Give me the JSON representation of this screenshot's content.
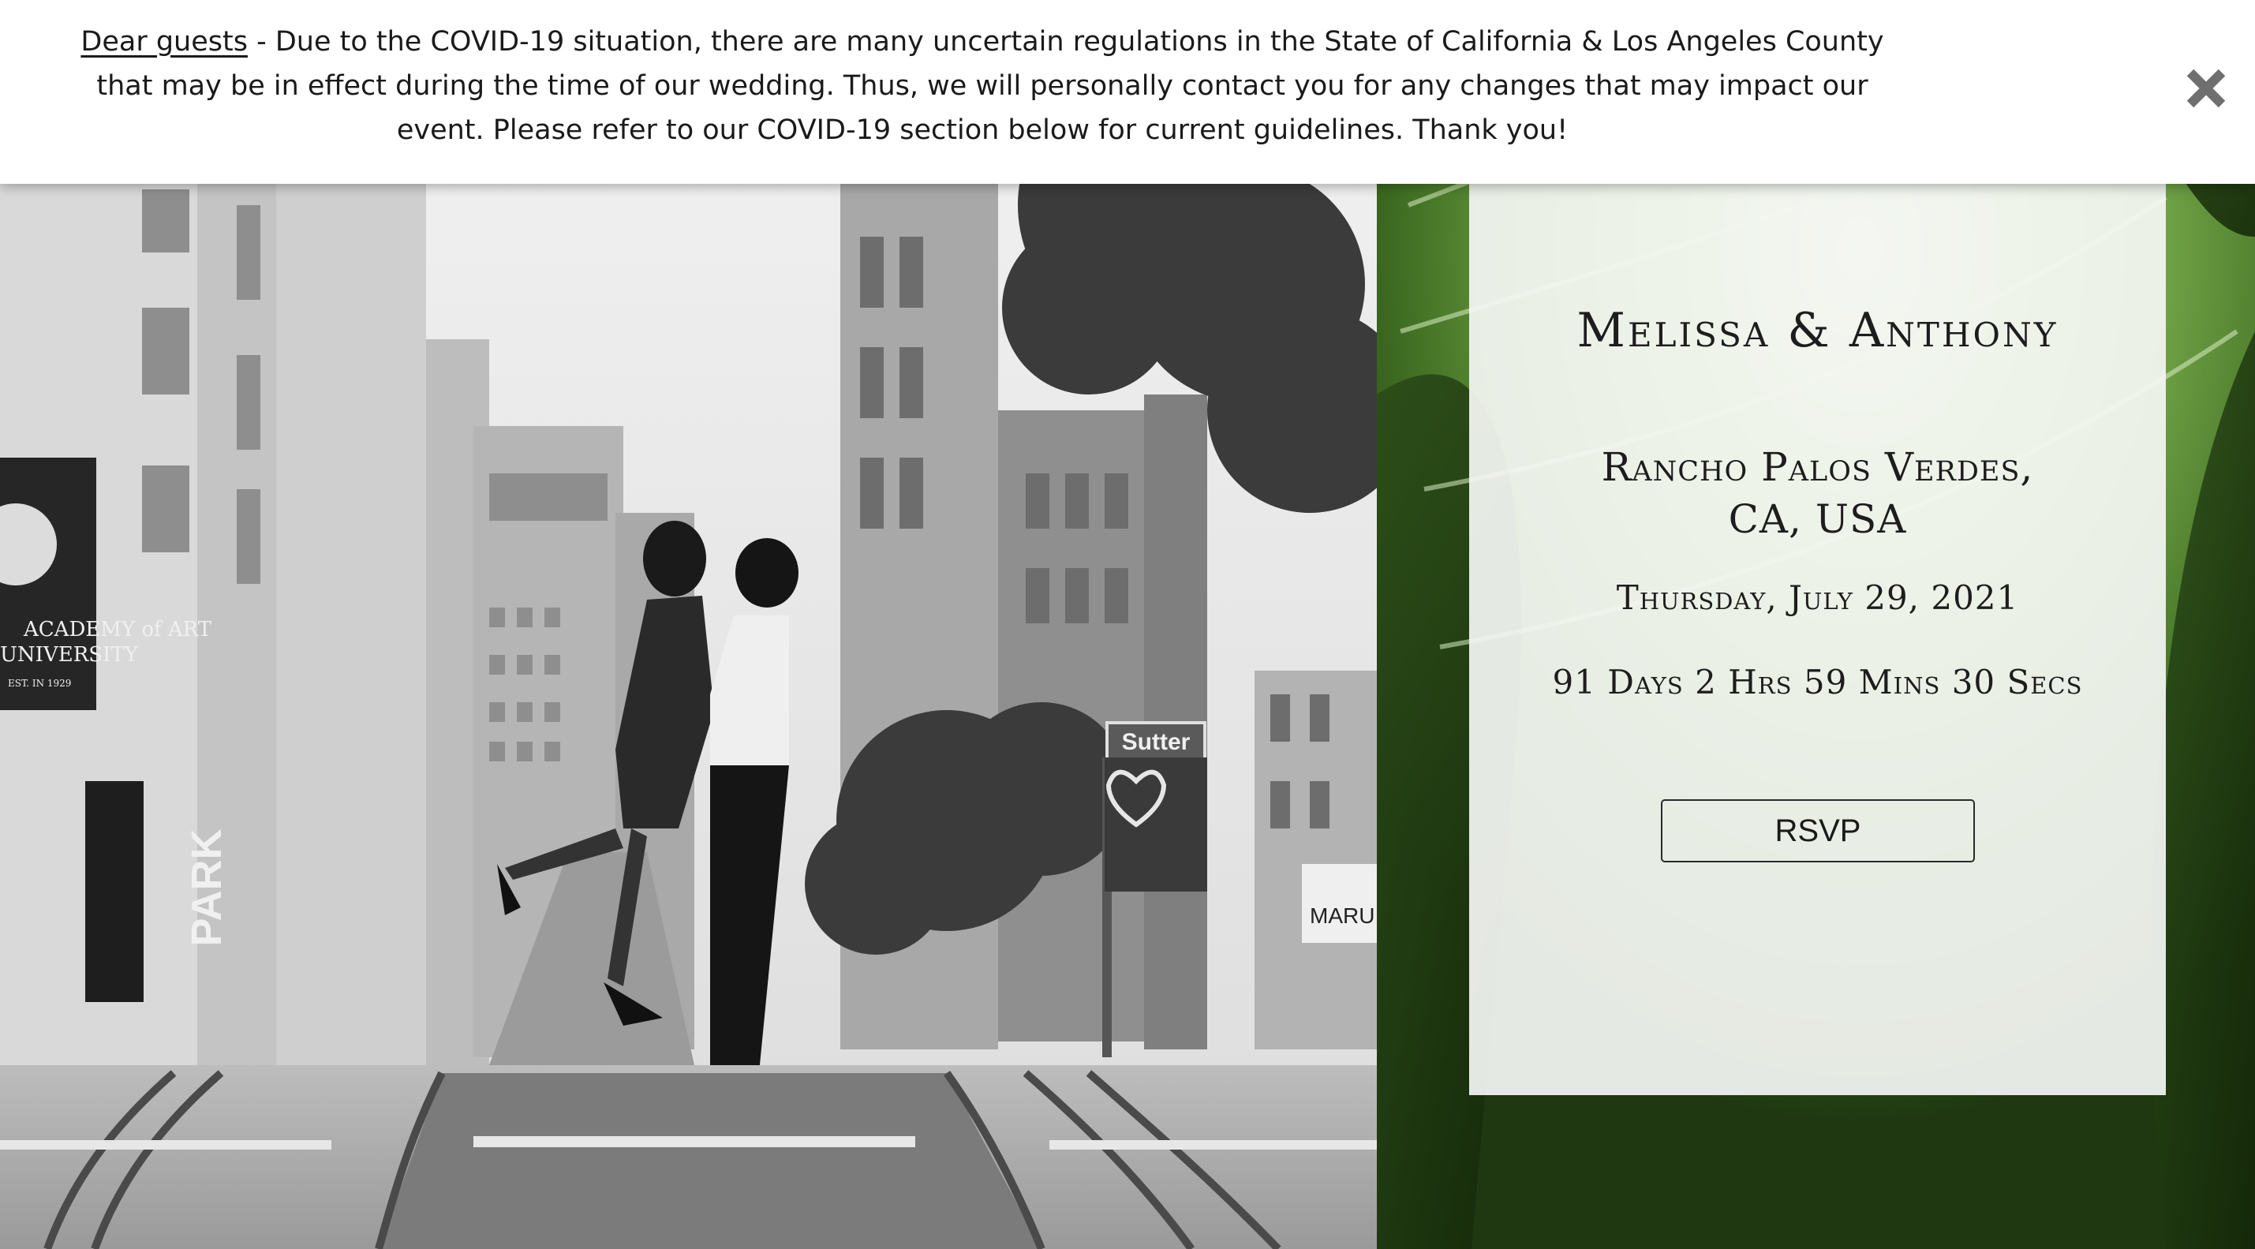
{
  "banner": {
    "lead": "Dear guests",
    "message": " - Due to the COVID-19 situation, there are many uncertain regulations in the State of California & Los Angeles County that may be in effect during the time of our wedding. Thus, we will personally contact you for any changes that may impact our event. Please refer to our COVID-19 section below for current guidelines. Thank you!",
    "close_icon": "close-x-icon"
  },
  "hero": {
    "photo": "couple-embracing-on-city-street-black-and-white",
    "signs": {
      "street_sign": "Sutter",
      "parking_sign": "PARK",
      "school_sign_line1": "ACADEMY of ART",
      "school_sign_line2": "UNIVERSITY",
      "school_sign_line3": "EST. IN 1929",
      "restaurant_sign": "MARU"
    }
  },
  "card": {
    "names": "Melissa & Anthony",
    "location_line1": "Rancho Palos Verdes,",
    "location_line2": "CA, USA",
    "date": "Thursday, July 29, 2021",
    "countdown": "91 Days 2 Hrs 59 Mins 30 Secs",
    "rsvp_label": "RSVP"
  },
  "colors": {
    "banner_bg": "#ffffff",
    "card_bg": "#f4f6f3",
    "palm_dark": "#1f3812",
    "palm_mid": "#3f6d22",
    "palm_light": "#8cc05a",
    "text": "#1d1d1d"
  }
}
